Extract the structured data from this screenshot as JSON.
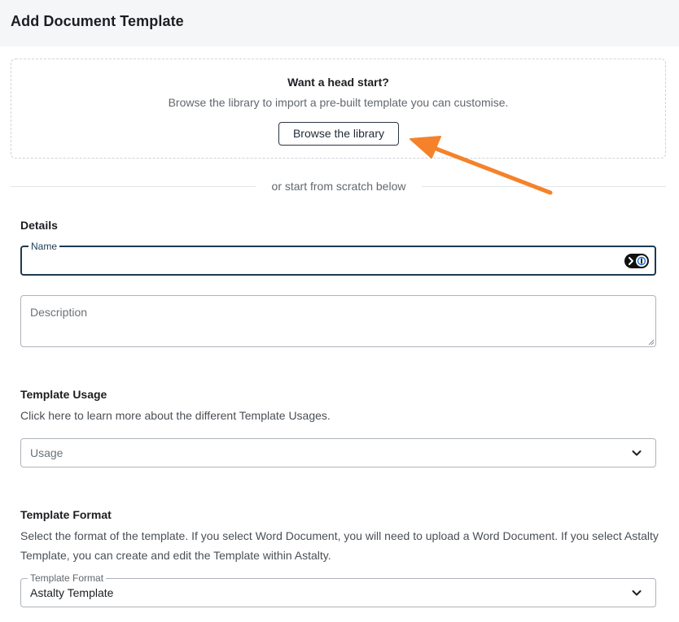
{
  "header": {
    "title": "Add Document Template"
  },
  "headstart": {
    "title": "Want a head start?",
    "subtitle": "Browse the library to import a pre-built template you can customise.",
    "browse_label": "Browse the library"
  },
  "divider": {
    "text": "or start from scratch below"
  },
  "details": {
    "title": "Details",
    "name_label": "Name",
    "name_value": "",
    "description_placeholder": "Description"
  },
  "usage": {
    "title": "Template Usage",
    "description": "Click here to learn more about the different Template Usages.",
    "select_placeholder": "Usage"
  },
  "format": {
    "title": "Template Format",
    "description": "Select the format of the template. If you select Word Document, you will need to upload a Word Document. If you select Astalty Template, you can create and edit the Template within Astalty.",
    "select_label": "Template Format",
    "select_value": "Astalty Template"
  },
  "colors": {
    "accent": "#1d3a52",
    "annotation_arrow": "#f5822a"
  },
  "icons": {
    "password_manager": "password-manager-icon",
    "chevron": "chevron-down-icon"
  }
}
